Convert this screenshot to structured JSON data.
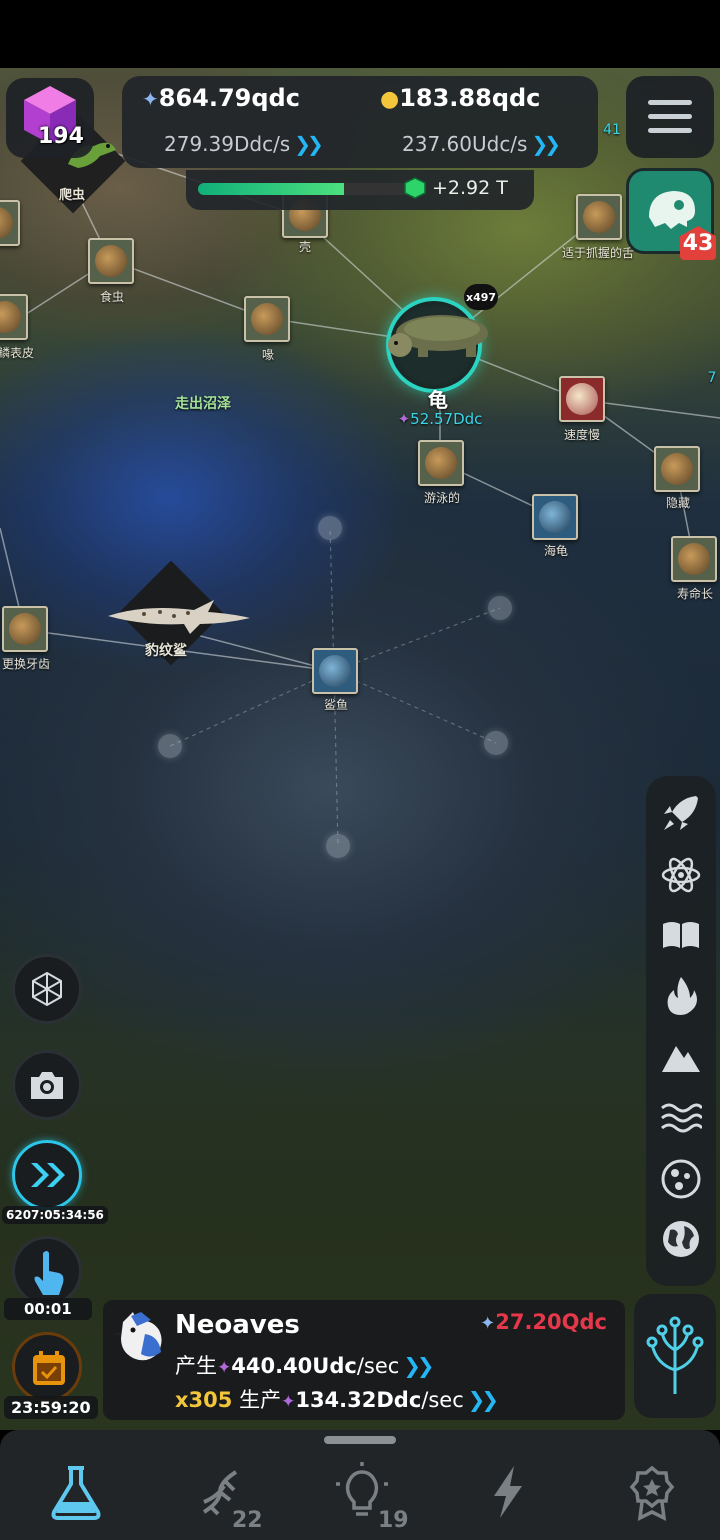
{
  "resources": {
    "cube_count": "194",
    "dna_amount": "864.79qdc",
    "dna_rate": "279.39Ddc/s",
    "idea_amount": "183.88qdc",
    "idea_rate": "237.60Udc/s",
    "progress_fraction": 0.68,
    "progress_text": "+2.92 T"
  },
  "dino_badge": "43",
  "map": {
    "region_label": "走出沼泽",
    "reptile_label": "爬虫",
    "shark_label": "豹纹鲨",
    "turtle": {
      "title": "龟",
      "value": "52.57Ddc",
      "multiplier": "x497"
    },
    "nodes": {
      "shell": "壳",
      "eat_insects": "食虫",
      "beak": "喙",
      "scaly_skin": "鳞表皮",
      "grasping_tongue": "适于抓握的舌",
      "slow": "速度慢",
      "swimming": "游泳的",
      "sea_turtle": "海龟",
      "hiding": "隐藏",
      "longevity": "寿命长",
      "replace_teeth": "更换牙齿",
      "shark": "鲨鱼"
    },
    "edge_partials": {
      "top_right": "41",
      "right": "7"
    }
  },
  "timers": {
    "fast_forward": "6207:05:34:56",
    "tap": "00:01",
    "daily": "23:59:20"
  },
  "species": {
    "name": "Neoaves",
    "price": "27.20Qdc",
    "produce_label": "产生",
    "produce_value": "440.40Udc",
    "produce_unit": "/sec",
    "multiplier": "x305",
    "production_label": "生产",
    "production_value": "134.32Ddc",
    "production_unit": "/sec"
  },
  "nav": {
    "dna_count": "22",
    "idea_count": "19"
  },
  "colors": {
    "accent_teal": "#2bd3c0",
    "accent_blue": "#23b8f5",
    "price_red": "#e5384a",
    "multiplier_yellow": "#f2c53a"
  },
  "icons": {
    "left": [
      "network-icon",
      "camera-icon",
      "fast-forward-icon",
      "tap-hand-icon",
      "calendar-icon"
    ],
    "right": [
      "rocket-icon",
      "atom-icon",
      "book-icon",
      "fire-icon",
      "mountain-icon",
      "waves-icon",
      "cell-icon",
      "globe-icon"
    ],
    "nav": [
      "flask-icon",
      "dna-icon",
      "lightbulb-icon",
      "lightning-icon",
      "medal-icon"
    ]
  }
}
